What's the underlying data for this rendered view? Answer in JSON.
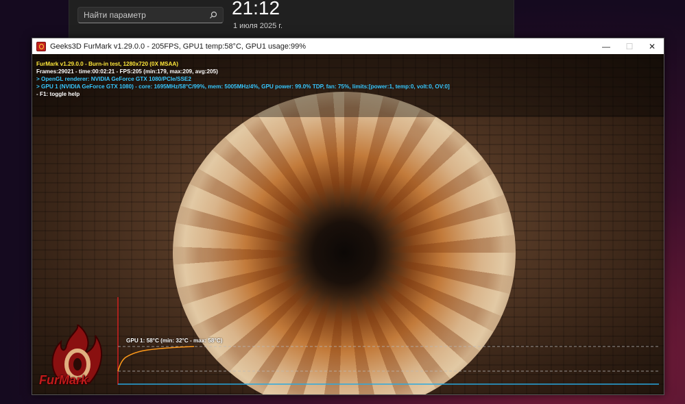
{
  "settings": {
    "search_placeholder": "Найти параметр",
    "time": "21:12",
    "date": "1 июля 2025 г."
  },
  "window": {
    "title": "Geeks3D FurMark v1.29.0.0 - 205FPS, GPU1 temp:58°C, GPU1 usage:99%",
    "minimize_glyph": "—",
    "maximize_glyph": "☐",
    "close_glyph": "✕"
  },
  "hud": {
    "line1": "FurMark v1.29.0.0 - Burn-in test, 1280x720 (0X MSAA)",
    "line2": "Frames:29021 - time:00:02:21 - FPS:205 (min:179, max:209, avg:205)",
    "line3": "> OpenGL renderer: NVIDIA GeForce GTX 1080/PCIe/SSE2",
    "line4": "> GPU 1 (NVIDIA GeForce GTX 1080) - core: 1695MHz/58°C/99%, mem: 5005MHz/4%, GPU power: 99.0% TDP, fan: 75%, limits:[power:1, temp:0, volt:0, OV:0]",
    "line5": "- F1: toggle help"
  },
  "graph": {
    "label": "GPU 1: 58°C (min: 32°C - max: 58°C)",
    "line_color": "#ff9a1a",
    "axis_color": "#2aa9e0"
  },
  "logo": {
    "text": "FurMark"
  },
  "colors": {
    "hud_yellow": "#ffe83a",
    "hud_cyan": "#37c8ff",
    "logo_red": "#c11b1b"
  }
}
